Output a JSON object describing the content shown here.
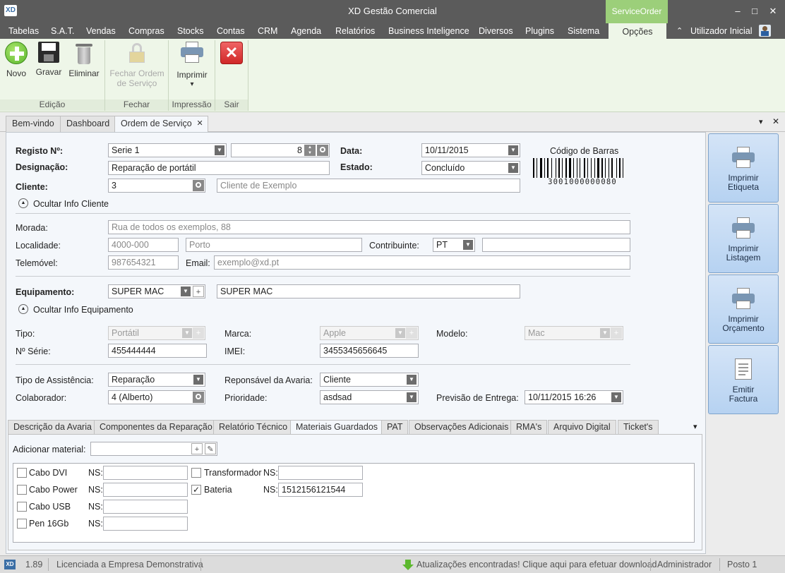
{
  "window": {
    "logo": "XD",
    "title": "XD Gestão Comercial",
    "context_group": "ServiceOrder",
    "minimize": "–",
    "maximize": "□",
    "close": "✕"
  },
  "menu": {
    "items": [
      "Tabelas",
      "S.A.T.",
      "Vendas",
      "Compras",
      "Stocks",
      "Contas",
      "CRM",
      "Agenda",
      "Relatórios",
      "Business Inteligence",
      "Diversos",
      "Plugins",
      "Sistema"
    ],
    "active": "Opções",
    "user": "Utilizador Inicial",
    "collapse": "⌃"
  },
  "ribbon": {
    "novo": "Novo",
    "gravar": "Gravar",
    "eliminar": "Eliminar",
    "fechar_ordem_1": "Fechar Ordem",
    "fechar_ordem_2": "de Serviço",
    "imprimir": "Imprimir",
    "imprimir_arrow": "▾",
    "groups": {
      "edicao": "Edição",
      "fechar": "Fechar",
      "impressao": "Impressão",
      "sair": "Sair"
    }
  },
  "tabs": {
    "items": [
      "Bem-vindo",
      "Dashboard",
      "Ordem de Serviço"
    ],
    "close": "✕",
    "menu": "▾",
    "close_all": "✕"
  },
  "form": {
    "registo_label": "Registo Nº:",
    "serie": "Serie 1",
    "numero": "8",
    "data_label": "Data:",
    "data": "10/11/2015",
    "codigo_barras_label": "Código de Barras",
    "barcode_number": "3001000000080",
    "designacao_label": "Designação:",
    "designacao": "Reparação de portátil",
    "estado_label": "Estado:",
    "estado": "Concluído",
    "cliente_label": "Cliente:",
    "cliente_id": "3",
    "cliente_nome": "Cliente de Exemplo",
    "toggle_cliente": "Ocultar Info Cliente",
    "morada_label": "Morada:",
    "morada": "Rua de todos os exemplos, 88",
    "localidade_label": "Localidade:",
    "codigo_postal": "4000-000",
    "localidade": "Porto",
    "contribuinte_label": "Contribuinte:",
    "pais": "PT",
    "contribuinte": "",
    "telemovel_label": "Telemóvel:",
    "telemovel": "987654321",
    "email_label": "Email:",
    "email": "exemplo@xd.pt",
    "equipamento_label": "Equipamento:",
    "equipamento": "SUPER MAC",
    "equipamento_desc": "SUPER MAC",
    "toggle_equipamento": "Ocultar Info Equipamento",
    "tipo_label": "Tipo:",
    "tipo": "Portátil",
    "marca_label": "Marca:",
    "marca": "Apple",
    "modelo_label": "Modelo:",
    "modelo": "Mac",
    "serie_label": "Nº Série:",
    "num_serie": "455444444",
    "imei_label": "IMEI:",
    "imei": "3455345656645",
    "tipo_assistencia_label": "Tipo de Assistência:",
    "tipo_assistencia": "Reparação",
    "responsavel_label": "Reponsável da Avaria:",
    "responsavel": "Cliente",
    "colaborador_label": "Colaborador:",
    "colaborador": "4 (Alberto)",
    "prioridade_label": "Prioridade:",
    "prioridade": "asdsad",
    "previsao_label": "Previsão de Entrega:",
    "previsao": "10/11/2015 16:26"
  },
  "side_buttons": {
    "etiqueta": [
      "Imprimir",
      "Etiqueta"
    ],
    "listagem": [
      "Imprimir",
      "Listagem"
    ],
    "orcamento": [
      "Imprimir",
      "Orçamento"
    ],
    "factura": [
      "Emitir",
      "Factura"
    ]
  },
  "subtabs": {
    "items": [
      "Descrição da Avaria",
      "Componentes da Reparação",
      "Relatório Técnico",
      "Materiais Guardados",
      "PAT",
      "Observações Adicionais",
      "RMA's",
      "Arquivo Digital",
      "Ticket's"
    ],
    "active": "Materiais Guardados",
    "more": "▾"
  },
  "materials": {
    "add_label": "Adicionar material:",
    "ns_label": "NS:",
    "items": [
      {
        "name": "Cabo DVI",
        "checked": false,
        "ns": ""
      },
      {
        "name": "Cabo Power",
        "checked": false,
        "ns": ""
      },
      {
        "name": "Cabo USB",
        "checked": false,
        "ns": ""
      },
      {
        "name": "Pen 16Gb",
        "checked": false,
        "ns": ""
      },
      {
        "name": "Transformador",
        "checked": false,
        "ns": ""
      },
      {
        "name": "Bateria",
        "checked": true,
        "ns": "1512156121544"
      }
    ],
    "check_mark": "✓"
  },
  "status": {
    "logo": "XD",
    "version": "1.89",
    "license": "Licenciada a Empresa Demonstrativa",
    "update": "Atualizações encontradas! Clique aqui para efetuar download",
    "user": "Administrador",
    "post": "Posto 1"
  },
  "glyphs": {
    "dd": "▼",
    "search": "🔍",
    "plus": "+",
    "edit": "✎",
    "up": "▲",
    "down": "▼",
    "collapse": "⌃"
  },
  "colors": {
    "titlebar": "#5b5b5b",
    "ribbon": "#eef6e8",
    "context": "#9ccf7a",
    "side_button": "#b6d2f1",
    "close_red": "#e03c3c",
    "add_green": "#5cb82e"
  }
}
